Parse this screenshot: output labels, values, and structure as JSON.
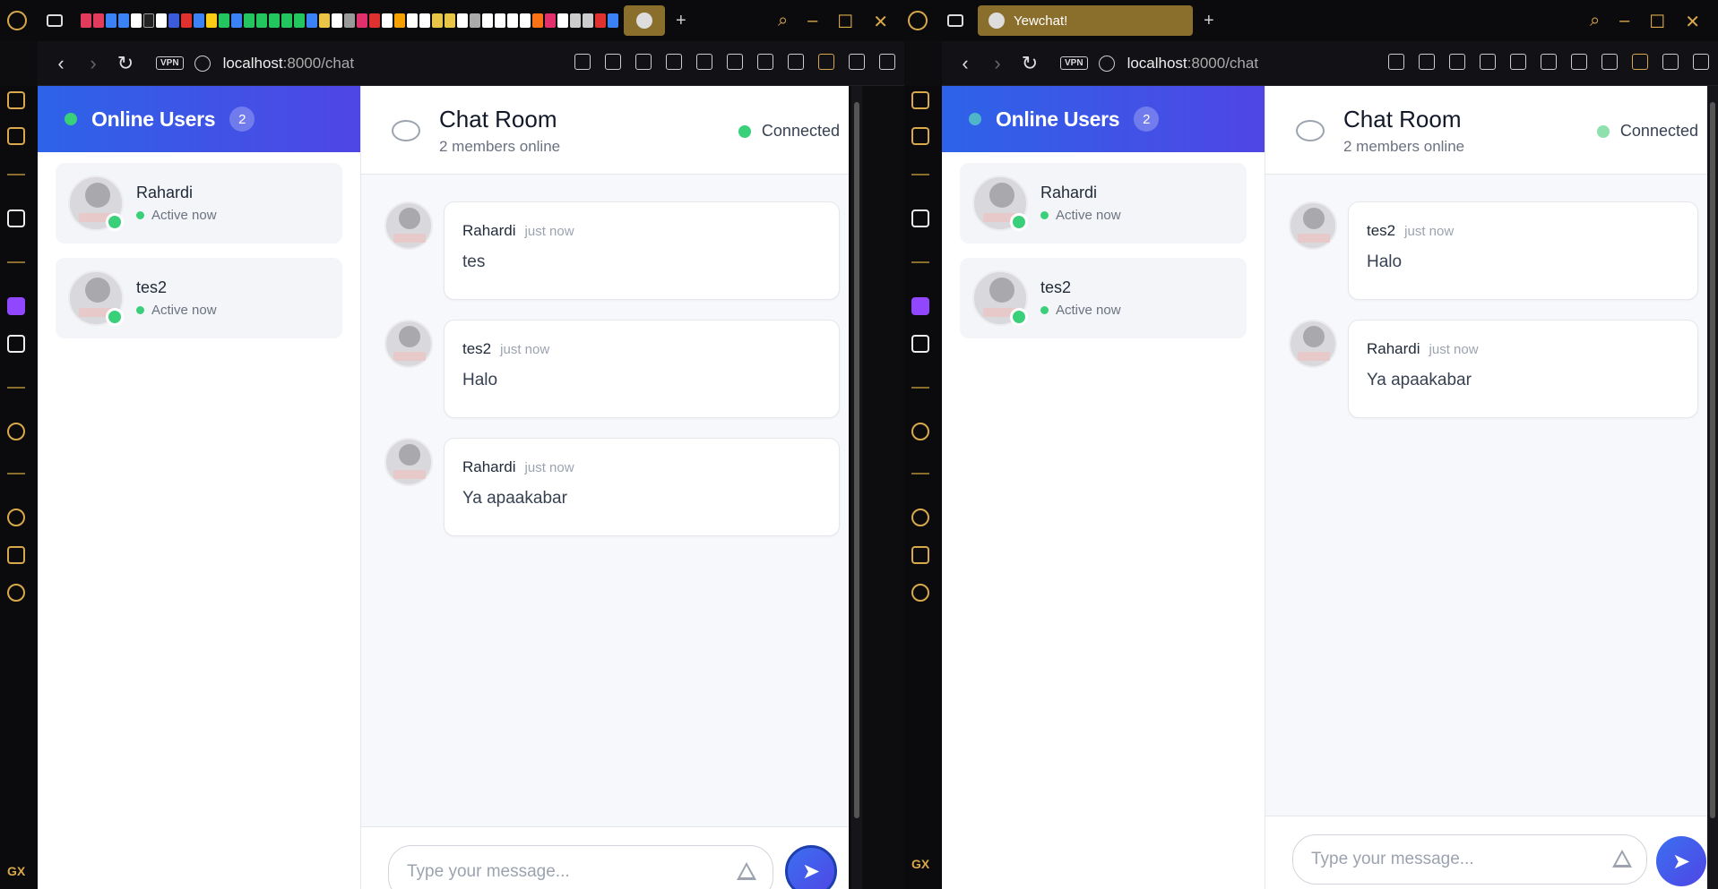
{
  "left": {
    "url": {
      "host": "localhost",
      "path": ":8000/chat"
    },
    "vpn": "VPN",
    "online": {
      "title": "Online Users",
      "count": "2"
    },
    "users": [
      {
        "name": "Rahardi",
        "status": "Active now"
      },
      {
        "name": "tes2",
        "status": "Active now"
      }
    ],
    "chat": {
      "title": "Chat Room",
      "subtitle": "2 members online",
      "connection": "Connected"
    },
    "messages": [
      {
        "author": "Rahardi",
        "time": "just now",
        "text": "tes"
      },
      {
        "author": "tes2",
        "time": "just now",
        "text": "Halo"
      },
      {
        "author": "Rahardi",
        "time": "just now",
        "text": "Ya apaakabar"
      }
    ],
    "input": {
      "placeholder": "Type your message..."
    }
  },
  "right": {
    "tab_title": "Yewchat!",
    "url": {
      "host": "localhost",
      "path": ":8000/chat"
    },
    "vpn": "VPN",
    "online": {
      "title": "Online Users",
      "count": "2"
    },
    "users": [
      {
        "name": "Rahardi",
        "status": "Active now"
      },
      {
        "name": "tes2",
        "status": "Active now"
      }
    ],
    "chat": {
      "title": "Chat Room",
      "subtitle": "2 members online",
      "connection": "Connected"
    },
    "messages": [
      {
        "author": "tes2",
        "time": "just now",
        "text": "Halo"
      },
      {
        "author": "Rahardi",
        "time": "just now",
        "text": "Ya apaakabar"
      }
    ],
    "input": {
      "placeholder": "Type your message..."
    }
  },
  "sidebar": {
    "brand": "GX"
  },
  "colors": {
    "accent": "#d9a84a",
    "header_gradient_start": "#2d63e8",
    "header_gradient_end": "#4f46e5",
    "online": "#3ad07a"
  }
}
